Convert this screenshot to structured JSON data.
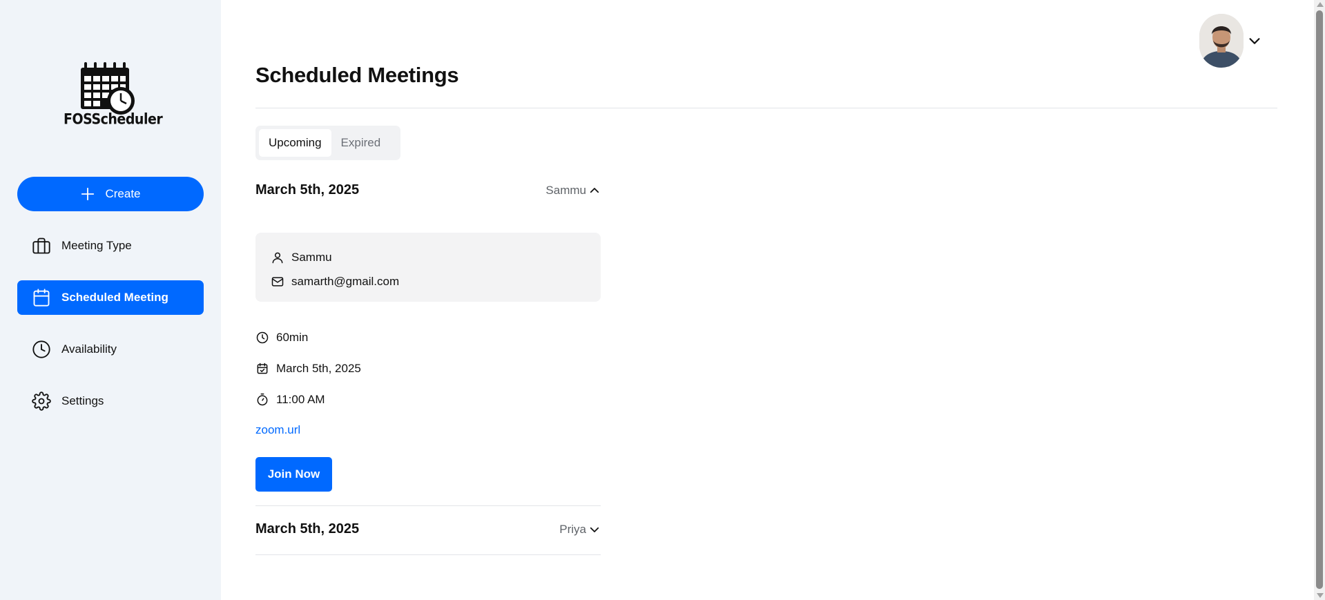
{
  "app": {
    "logo_text": "FOSScheduler"
  },
  "sidebar": {
    "create_label": "Create",
    "items": [
      {
        "label": "Meeting Type",
        "icon": "briefcase-icon",
        "active": false
      },
      {
        "label": "Scheduled Meeting",
        "icon": "calendar-icon",
        "active": true
      },
      {
        "label": "Availability",
        "icon": "clock-icon",
        "active": false
      },
      {
        "label": "Settings",
        "icon": "gear-icon",
        "active": false
      }
    ]
  },
  "header": {
    "title": "Scheduled Meetings",
    "avatar": "user-avatar"
  },
  "tabs": [
    {
      "label": "Upcoming",
      "active": true
    },
    {
      "label": "Expired",
      "active": false
    }
  ],
  "meetings": [
    {
      "date": "March 5th, 2025",
      "person": "Sammu",
      "expanded": true,
      "attendee_name": "Sammu",
      "attendee_email": "samarth@gmail.com",
      "duration": "60min",
      "meeting_date": "March 5th, 2025",
      "time": "11:00 AM",
      "url": "zoom.url",
      "join_label": "Join Now"
    },
    {
      "date": "March 5th, 2025",
      "person": "Priya",
      "expanded": false
    }
  ],
  "colors": {
    "primary": "#0069ff",
    "sidebar_bg": "#f0f4f9",
    "card_bg": "#f3f3f4"
  }
}
